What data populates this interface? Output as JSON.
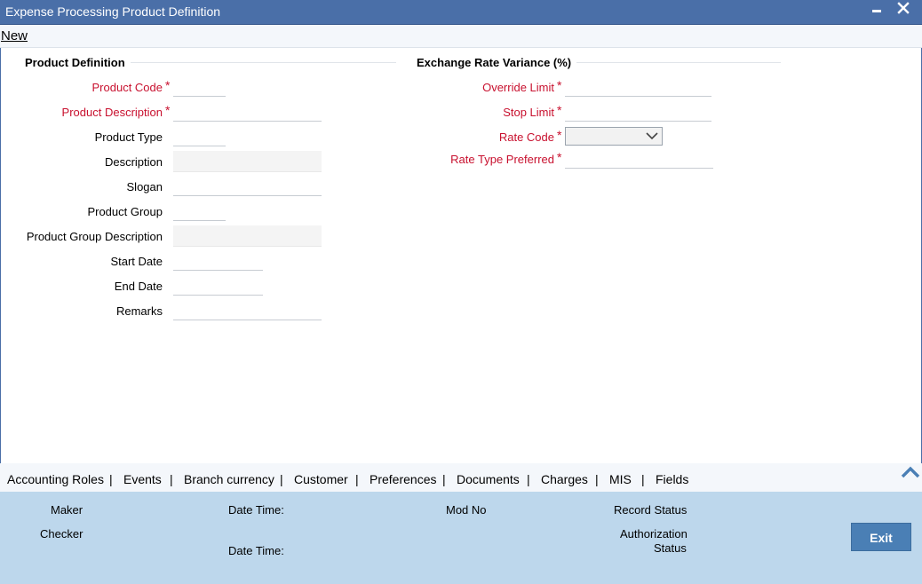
{
  "window": {
    "title": "Expense Processing Product Definition",
    "minimize_glyph": "▬",
    "close_glyph": "✕"
  },
  "menu": {
    "new_label": "New"
  },
  "product_definition": {
    "section_title": "Product Definition",
    "product_code_label": "Product Code",
    "product_code_value": "",
    "product_description_label": "Product Description",
    "product_description_value": "",
    "product_type_label": "Product Type",
    "product_type_value": "",
    "description_label": "Description",
    "description_value": "",
    "slogan_label": "Slogan",
    "slogan_value": "",
    "product_group_label": "Product Group",
    "product_group_value": "",
    "product_group_description_label": "Product Group Description",
    "product_group_description_value": "",
    "start_date_label": "Start Date",
    "start_date_value": "",
    "end_date_label": "End Date",
    "end_date_value": "",
    "remarks_label": "Remarks",
    "remarks_value": ""
  },
  "exchange_rate": {
    "section_title": "Exchange Rate Variance (%)",
    "override_limit_label": "Override Limit",
    "override_limit_value": "",
    "stop_limit_label": "Stop Limit",
    "stop_limit_value": "",
    "rate_code_label": "Rate Code",
    "rate_code_value": "",
    "rate_type_preferred_label": "Rate Type Preferred",
    "rate_type_preferred_value": ""
  },
  "required_mark": "*",
  "tabs": {
    "accounting_roles": "Accounting Roles",
    "events": "Events",
    "branch_currency": "Branch currency",
    "customer": "Customer",
    "preferences": "Preferences",
    "documents": "Documents",
    "charges": "Charges",
    "mis": "MIS",
    "fields": "Fields",
    "separator": "|"
  },
  "footer": {
    "maker_label": "Maker",
    "checker_label": "Checker",
    "date_time_label": "Date Time:",
    "mod_no_label": "Mod No",
    "record_status_label": "Record Status",
    "authorization_label": "Authorization",
    "status_label": "Status",
    "exit_label": "Exit"
  },
  "colors": {
    "title_bar": "#4a6fa8",
    "required_red": "#c8102e",
    "footer_bg": "#bdd7ec",
    "exit_button": "#4a7fb5"
  },
  "icons": {
    "minimize": "minimize-icon",
    "close": "close-icon",
    "dropdown": "chevron-down-icon",
    "collapse": "chevron-up-icon"
  }
}
